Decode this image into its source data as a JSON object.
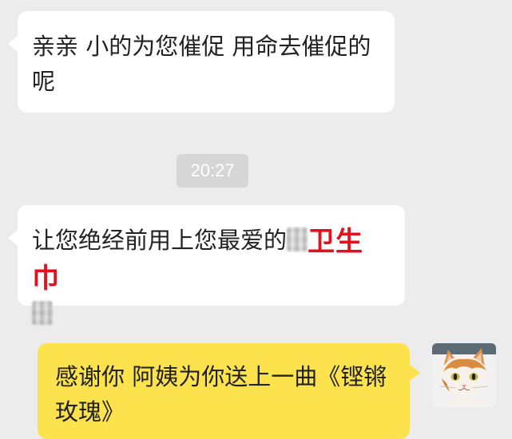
{
  "messages": [
    {
      "side": "left",
      "text": "亲亲 小的为您催促 用命去催促的呢"
    },
    {
      "side": "left",
      "text_before": "让您绝经前用上您最爱的",
      "redacted_label": "卫生巾"
    },
    {
      "side": "right",
      "text": "感谢你 阿姨为你送上一曲《铿锵玫瑰》"
    }
  ],
  "timestamp": "20:27",
  "colors": {
    "background": "#ececec",
    "incoming_bubble": "#ffffff",
    "outgoing_bubble": "#fce24c",
    "highlight_red": "#e4101e",
    "timestamp_bg": "#d6d6d6"
  },
  "icons": {
    "avatar": "kitten-avatar"
  }
}
